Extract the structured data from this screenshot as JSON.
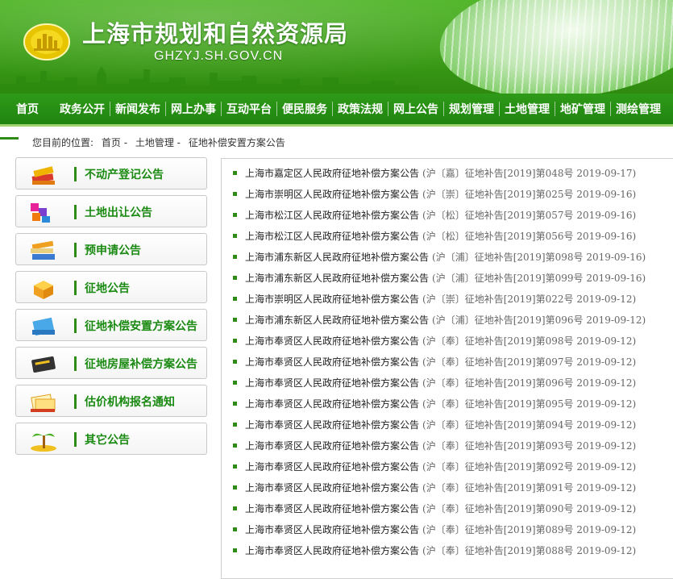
{
  "header": {
    "title": "上海市规划和自然资源局",
    "domain": "GHZYJ.SH.GOV.CN"
  },
  "nav": [
    "首页",
    "政务公开",
    "新闻发布",
    "网上办事",
    "互动平台",
    "便民服务",
    "政策法规",
    "网上公告",
    "规划管理",
    "土地管理",
    "地矿管理",
    "测绘管理"
  ],
  "breadcrumb": {
    "label": "您目前的位置:",
    "items": [
      "首页 -",
      "土地管理 -",
      "征地补偿安置方案公告"
    ]
  },
  "sidebar": [
    {
      "label": "不动产登记公告",
      "icon": "book-stack-icon"
    },
    {
      "label": "土地出让公告",
      "icon": "colored-blocks-icon"
    },
    {
      "label": "预申请公告",
      "icon": "folder-stack-icon"
    },
    {
      "label": "征地公告",
      "icon": "package-box-icon"
    },
    {
      "label": "征地补偿安置方案公告",
      "icon": "blue-book-icon"
    },
    {
      "label": "征地房屋补偿方案公告",
      "icon": "dark-book-icon"
    },
    {
      "label": "估价机构报名通知",
      "icon": "documents-icon"
    },
    {
      "label": "其它公告",
      "icon": "palm-tree-icon"
    }
  ],
  "notices": [
    {
      "title": "上海市嘉定区人民政府征地补偿方案公告",
      "meta": "(沪〔嘉〕征地补告[2019]第048号 2019-09-17)"
    },
    {
      "title": "上海市崇明区人民政府征地补偿方案公告",
      "meta": "(沪〔崇〕征地补告[2019]第025号 2019-09-16)"
    },
    {
      "title": "上海市松江区人民政府征地补偿方案公告",
      "meta": "(沪〔松〕征地补告[2019]第057号 2019-09-16)"
    },
    {
      "title": "上海市松江区人民政府征地补偿方案公告",
      "meta": "(沪〔松〕征地补告[2019]第056号 2019-09-16)"
    },
    {
      "title": "上海市浦东新区人民政府征地补偿方案公告",
      "meta": "(沪〔浦〕征地补告[2019]第098号 2019-09-16)"
    },
    {
      "title": "上海市浦东新区人民政府征地补偿方案公告",
      "meta": "(沪〔浦〕征地补告[2019]第099号 2019-09-16)"
    },
    {
      "title": "上海市崇明区人民政府征地补偿方案公告",
      "meta": "(沪〔崇〕征地补告[2019]第022号 2019-09-12)"
    },
    {
      "title": "上海市浦东新区人民政府征地补偿方案公告",
      "meta": "(沪〔浦〕征地补告[2019]第096号 2019-09-12)"
    },
    {
      "title": "上海市奉贤区人民政府征地补偿方案公告",
      "meta": "(沪〔奉〕征地补告[2019]第098号 2019-09-12)"
    },
    {
      "title": "上海市奉贤区人民政府征地补偿方案公告",
      "meta": "(沪〔奉〕征地补告[2019]第097号 2019-09-12)"
    },
    {
      "title": "上海市奉贤区人民政府征地补偿方案公告",
      "meta": "(沪〔奉〕征地补告[2019]第096号 2019-09-12)"
    },
    {
      "title": "上海市奉贤区人民政府征地补偿方案公告",
      "meta": "(沪〔奉〕征地补告[2019]第095号 2019-09-12)"
    },
    {
      "title": "上海市奉贤区人民政府征地补偿方案公告",
      "meta": "(沪〔奉〕征地补告[2019]第094号 2019-09-12)"
    },
    {
      "title": "上海市奉贤区人民政府征地补偿方案公告",
      "meta": "(沪〔奉〕征地补告[2019]第093号 2019-09-12)"
    },
    {
      "title": "上海市奉贤区人民政府征地补偿方案公告",
      "meta": "(沪〔奉〕征地补告[2019]第092号 2019-09-12)"
    },
    {
      "title": "上海市奉贤区人民政府征地补偿方案公告",
      "meta": "(沪〔奉〕征地补告[2019]第091号 2019-09-12)"
    },
    {
      "title": "上海市奉贤区人民政府征地补偿方案公告",
      "meta": "(沪〔奉〕征地补告[2019]第090号 2019-09-12)"
    },
    {
      "title": "上海市奉贤区人民政府征地补偿方案公告",
      "meta": "(沪〔奉〕征地补告[2019]第089号 2019-09-12)"
    },
    {
      "title": "上海市奉贤区人民政府征地补偿方案公告",
      "meta": "(沪〔奉〕征地补告[2019]第088号 2019-09-12)"
    }
  ],
  "colors": {
    "brand_green": "#2e8b16",
    "link_green": "#1a8a12",
    "nav_bg": "#1f8410"
  }
}
